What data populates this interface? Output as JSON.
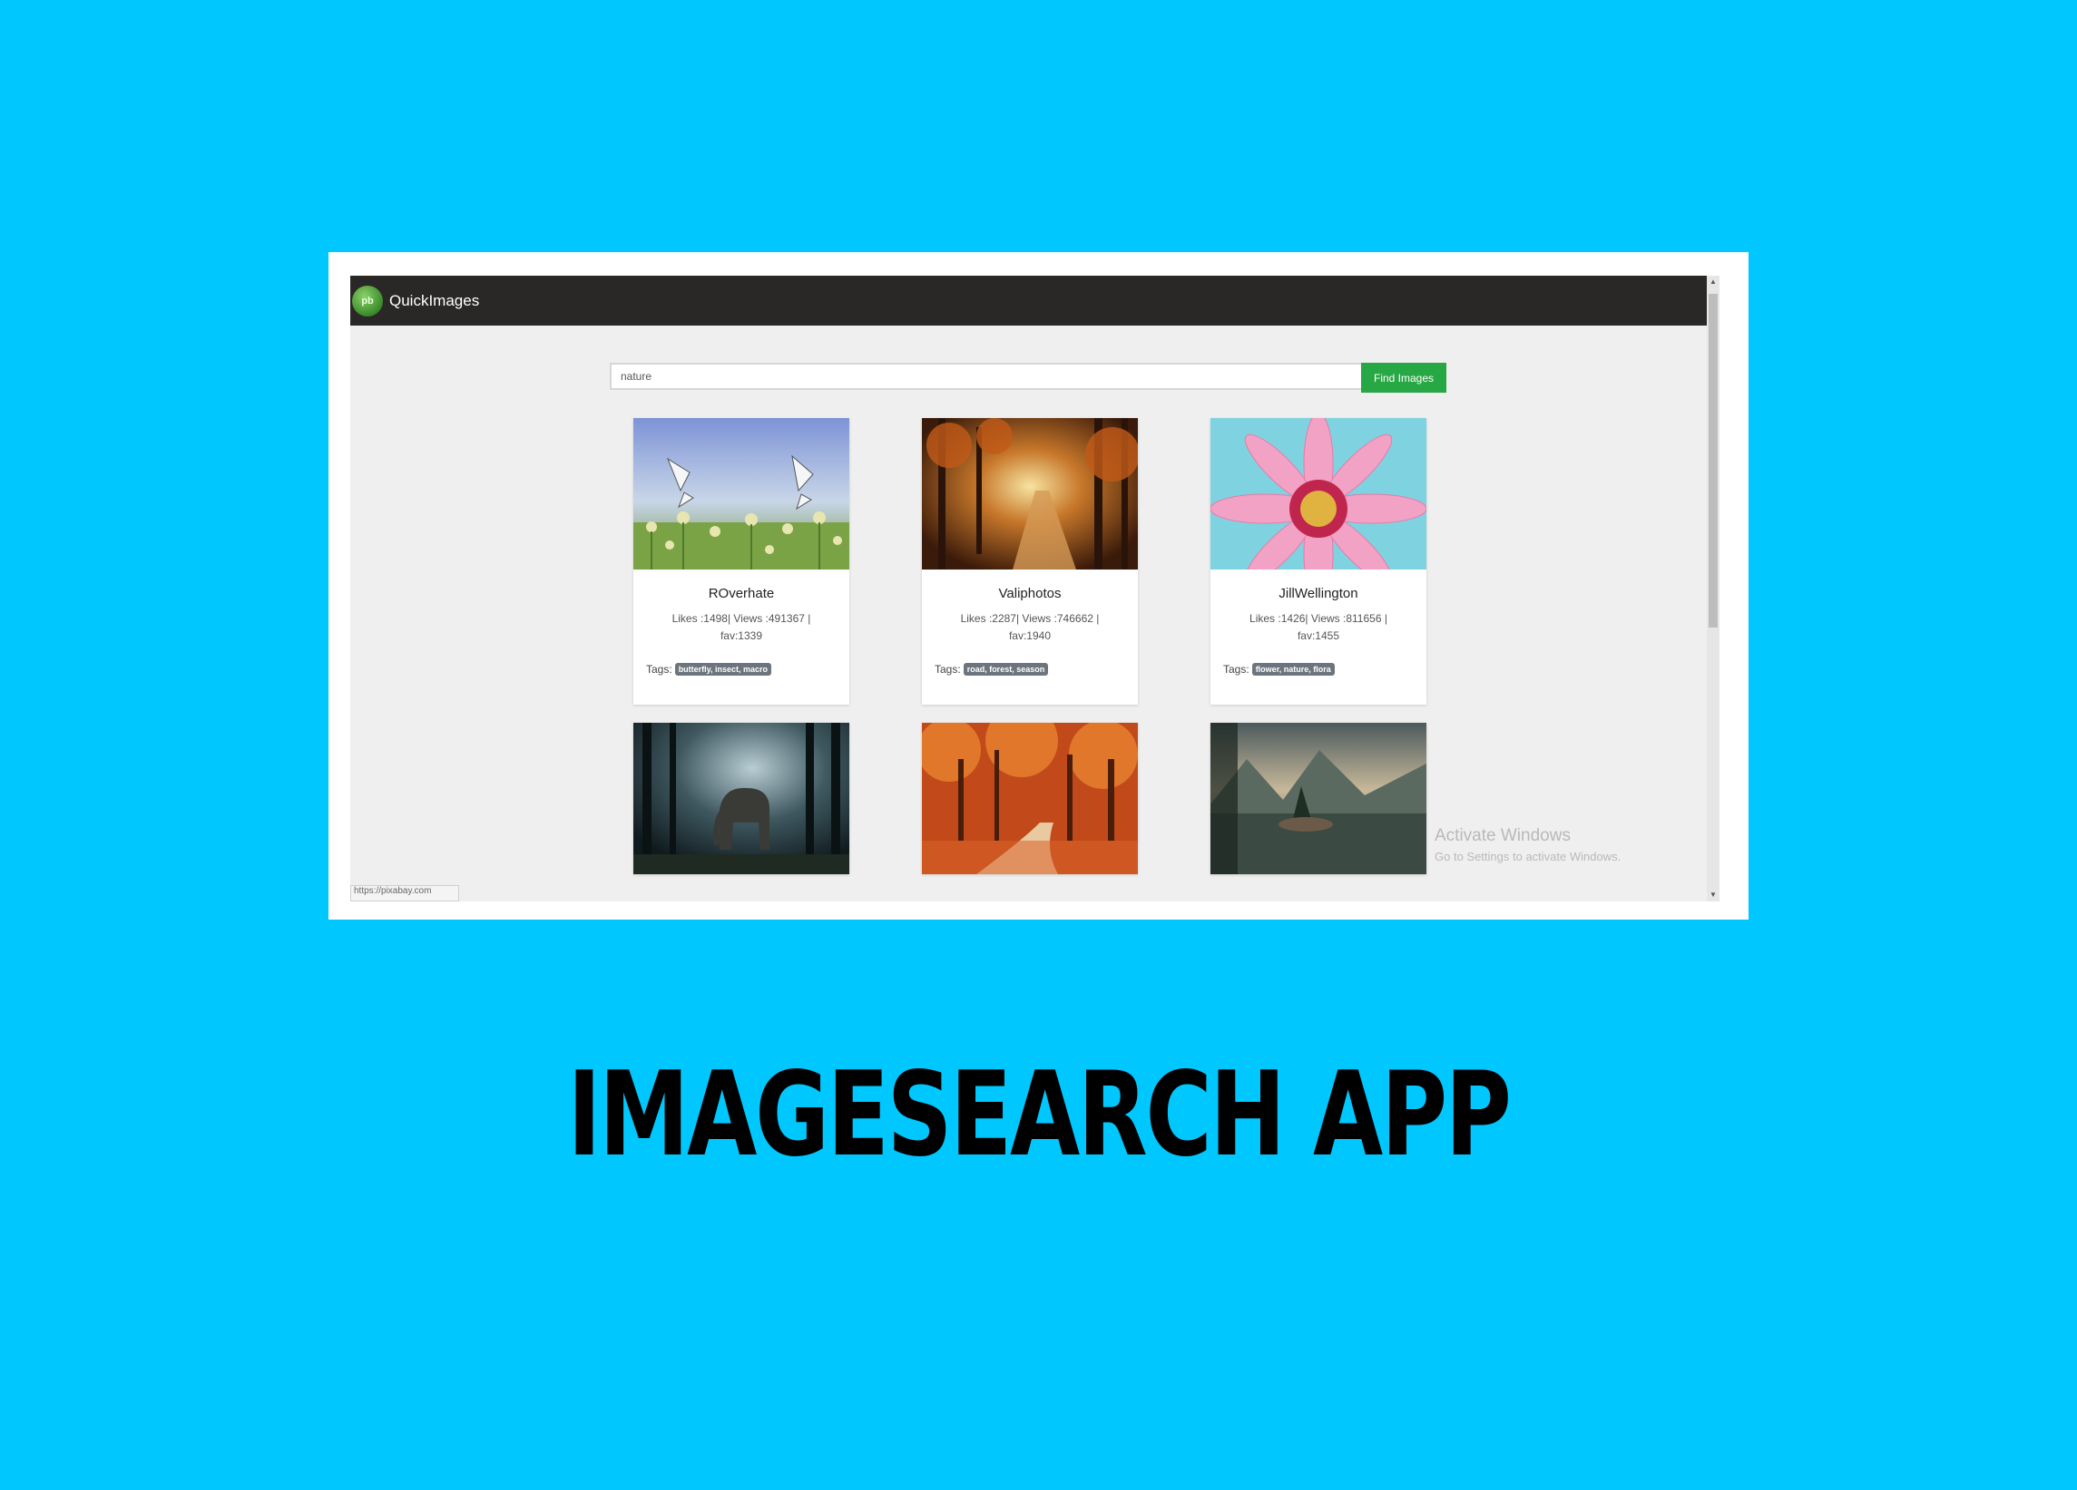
{
  "app": {
    "brand": "QuickImages",
    "logo_text": "pb"
  },
  "search": {
    "value": "nature",
    "button_label": "Find Images"
  },
  "cards": [
    {
      "author": "ROverhate",
      "stats": "Likes :1498| Views :491367 | fav:1339",
      "tags_label": "Tags:",
      "tags": "butterfly, insect, macro"
    },
    {
      "author": "Valiphotos",
      "stats": "Likes :2287| Views :746662 | fav:1940",
      "tags_label": "Tags:",
      "tags": "road, forest, season"
    },
    {
      "author": "JillWellington",
      "stats": "Likes :1426| Views :811656 | fav:1455",
      "tags_label": "Tags:",
      "tags": "flower, nature, flora"
    }
  ],
  "status_url": "https://pixabay.com",
  "watermark": {
    "title": "Activate Windows",
    "subtitle": "Go to Settings to activate Windows."
  },
  "headline": "IMAGESEARCH APP",
  "colors": {
    "background": "#00c8ff",
    "navbar": "#2a2827",
    "button": "#28a745",
    "tag": "#6c757d"
  }
}
